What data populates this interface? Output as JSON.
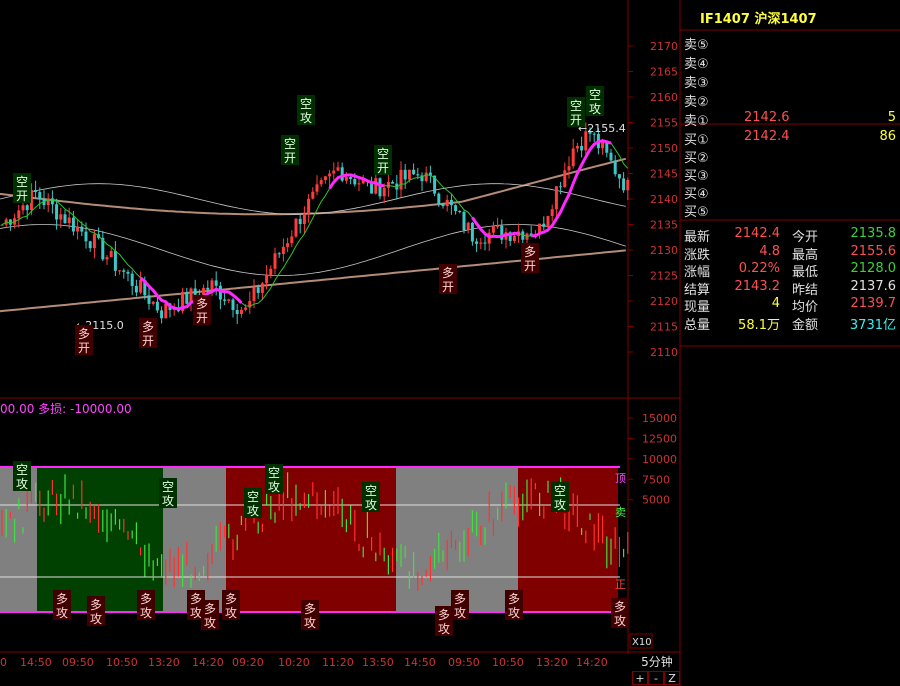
{
  "ticker": {
    "code": "IF1407",
    "name": "沪深1407"
  },
  "order_book": {
    "asks": [
      {
        "label": "卖⑤",
        "price": "",
        "volume": ""
      },
      {
        "label": "卖④",
        "price": "",
        "volume": ""
      },
      {
        "label": "卖③",
        "price": "",
        "volume": ""
      },
      {
        "label": "卖②",
        "price": "",
        "volume": ""
      },
      {
        "label": "卖①",
        "price": "2142.6",
        "volume": "5"
      }
    ],
    "bids": [
      {
        "label": "买①",
        "price": "2142.4",
        "volume": "86"
      },
      {
        "label": "买②",
        "price": "",
        "volume": ""
      },
      {
        "label": "买③",
        "price": "",
        "volume": ""
      },
      {
        "label": "买④",
        "price": "",
        "volume": ""
      },
      {
        "label": "买⑤",
        "price": "",
        "volume": ""
      }
    ]
  },
  "quote": [
    {
      "l1": "最新",
      "v1": "2142.4",
      "c1": "#ff5050",
      "l2": "今开",
      "v2": "2135.8",
      "c2": "#3cd23c"
    },
    {
      "l1": "涨跌",
      "v1": "4.8",
      "c1": "#ff5050",
      "l2": "最高",
      "v2": "2155.6",
      "c2": "#ff5050"
    },
    {
      "l1": "涨幅",
      "v1": "0.22%",
      "c1": "#ff5050",
      "l2": "最低",
      "v2": "2128.0",
      "c2": "#3cd23c"
    },
    {
      "l1": "结算",
      "v1": "2143.2",
      "c1": "#ff5050",
      "l2": "昨结",
      "v2": "2137.6",
      "c2": "#e0e0e0"
    },
    {
      "l1": "现量",
      "v1": "4",
      "c1": "#ffff3c",
      "l2": "均价",
      "v2": "2139.7",
      "c2": "#ff5050"
    },
    {
      "l1": "总量",
      "v1": "58.1万",
      "c1": "#ffff3c",
      "l2": "金额",
      "v2": "3731亿",
      "c2": "#3cf0f0"
    }
  ],
  "price_axis": [
    "2170",
    "2165",
    "2160",
    "2155",
    "2150",
    "2145",
    "2140",
    "2135",
    "2130",
    "2125",
    "2120",
    "2115",
    "2110"
  ],
  "indicator_axis": [
    "15000",
    "12500",
    "10000",
    "7500",
    "5000"
  ],
  "indicator_label": "00.00 多损: -10000.00",
  "indicator_side_labels": {
    "top": "顶",
    "sell": "卖",
    "bottom": "正"
  },
  "time_axis": [
    "0",
    "14:50",
    "09:50",
    "10:50",
    "13:20",
    "14:20",
    "09:20",
    "10:20",
    "11:20",
    "13:50",
    "14:50",
    "09:50",
    "10:50",
    "13:20",
    "14:20"
  ],
  "timeframe": "5分钟",
  "toolbar": {
    "plus": "+",
    "minus": "-",
    "zoom": "Z"
  },
  "zoom_label": "X10",
  "annotations": {
    "high_price": "2155.4",
    "low_price": "2115.0",
    "short_open": "空开",
    "short_attack": "空攻",
    "long_open": "多开",
    "long_attack": "多攻"
  },
  "colors": {
    "up": "#ff3c3c",
    "down": "#3cc8c8",
    "band": "#b48c78",
    "signal": "#ff28ff",
    "green_line": "#28c828",
    "zone_red": "#800000",
    "zone_green": "#004000",
    "zone_gray": "#808080",
    "axis": "#800000"
  }
}
